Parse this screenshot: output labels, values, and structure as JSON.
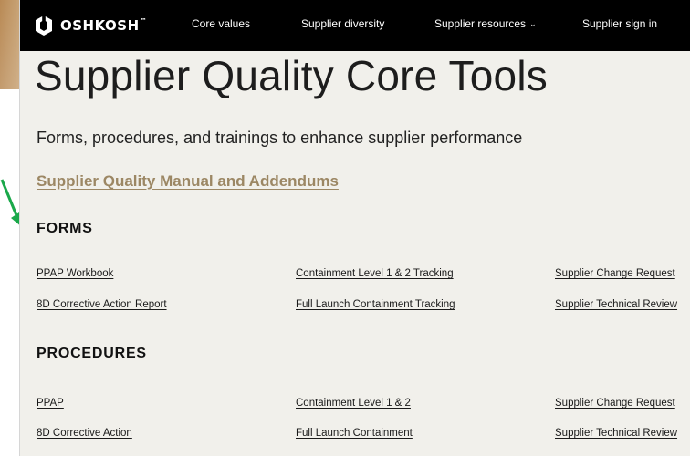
{
  "brand": {
    "logo_text": "OSHKOSH",
    "trademark": "™"
  },
  "nav": {
    "items": [
      {
        "label": "Core values"
      },
      {
        "label": "Supplier diversity"
      },
      {
        "label": "Supplier resources"
      },
      {
        "label": "Supplier sign in"
      }
    ]
  },
  "page": {
    "title": "Supplier Quality Core Tools",
    "subtitle": "Forms, procedures, and trainings to enhance supplier performance",
    "manual_link": "Supplier Quality Manual and Addendums"
  },
  "forms": {
    "heading": "FORMS",
    "links": [
      "PPAP Workbook",
      "Containment Level 1 & 2 Tracking",
      "Supplier Change Request",
      "8D Corrective Action Report",
      "Full Launch Containment Tracking",
      "Supplier Technical Review"
    ]
  },
  "procedures": {
    "heading": "PROCEDURES",
    "links": [
      "PPAP",
      "Containment Level 1 & 2",
      "Supplier Change Request",
      "8D Corrective Action",
      "Full Launch Containment",
      "Supplier Technical Review"
    ]
  },
  "colors": {
    "nav_background": "#000000",
    "page_background": "#f1f0eb",
    "accent_link": "#9c8764",
    "annotation_arrow": "#1aa84a"
  },
  "icons": {
    "dropdown": "chevron-down-icon",
    "logo": "oshkosh-logo-icon",
    "annotation": "green-arrow-icon"
  }
}
